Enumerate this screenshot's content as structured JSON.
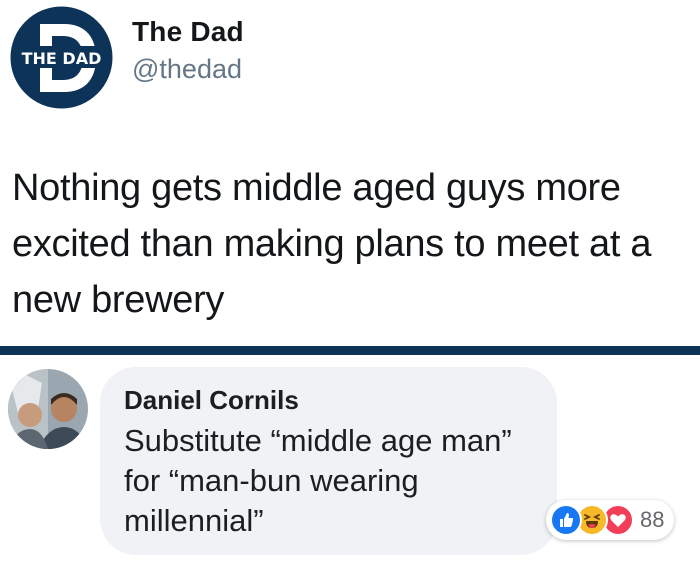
{
  "tweet": {
    "avatar_text": "THE DAD",
    "display_name": "The Dad",
    "handle": "@thedad",
    "text": "Nothing gets middle aged guys more excited than making plans to meet at a new brewery"
  },
  "comment": {
    "author": "Daniel Cornils",
    "text": "Substitute “middle age man” for “man-bun wearing millennial”",
    "reactions": {
      "icons": [
        "like-icon",
        "haha-icon",
        "love-icon"
      ],
      "count": "88"
    }
  },
  "colors": {
    "brand_navy": "#0d3358",
    "like_blue": "#1877f2",
    "haha_yellow": "#f7b928",
    "love_red": "#f33e58",
    "bubble_gray": "#f0f2f5"
  }
}
